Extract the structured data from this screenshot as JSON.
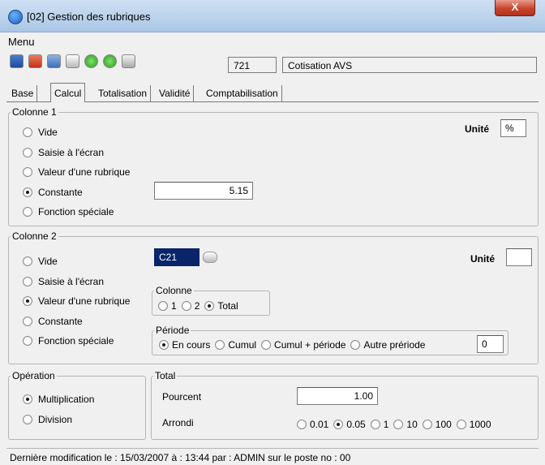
{
  "window": {
    "title": "[02] Gestion des rubriques",
    "close_label": "X"
  },
  "menu": {
    "label": "Menu"
  },
  "toolbar": {
    "buttons": [
      "save-icon",
      "delete-icon",
      "refresh-icon",
      "view-icon",
      "back-icon",
      "forward-icon",
      "print-icon"
    ],
    "code": "721",
    "name": "Cotisation AVS"
  },
  "tabs": [
    "Base",
    "Calcul",
    "Totalisation",
    "Validité",
    "Comptabilisation"
  ],
  "active_tab": "Calcul",
  "colonne1": {
    "legend": "Colonne 1",
    "options": [
      "Vide",
      "Saisie à l'écran",
      "Valeur d'une rubrique",
      "Constante",
      "Fonction spéciale"
    ],
    "selected": "Constante",
    "constante_value": "5.15",
    "unite_label": "Unité",
    "unite_value": "%"
  },
  "colonne2": {
    "legend": "Colonne 2",
    "options": [
      "Vide",
      "Saisie à l'écran",
      "Valeur d'une rubrique",
      "Constante",
      "Fonction spéciale"
    ],
    "selected": "Valeur d'une rubrique",
    "rubrique_value": "C21",
    "unite_label": "Unité",
    "unite_value": "",
    "colonne_group": {
      "legend": "Colonne",
      "opt1": "1",
      "opt2": "2",
      "opt3": "Total",
      "selected": "Total"
    },
    "periode_group": {
      "legend": "Période",
      "opt1": "En cours",
      "opt2": "Cumul",
      "opt3": "Cumul + période",
      "opt4": "Autre prériode",
      "selected": "En cours",
      "value": "0"
    }
  },
  "operation": {
    "legend": "Opération",
    "options": [
      "Multiplication",
      "Division"
    ],
    "selected": "Multiplication"
  },
  "total": {
    "legend": "Total",
    "pourcent_label": "Pourcent",
    "pourcent_value": "1.00",
    "arrondi_label": "Arrondi",
    "arrondi_options": [
      "0.01",
      "0.05",
      "1",
      "10",
      "100",
      "1000"
    ],
    "arrondi_selected": "0.05"
  },
  "status": {
    "text": "Dernière modification le : 15/03/2007 à : 13:44 par : ADMIN      sur le poste no : 00"
  },
  "colors": {
    "selection": "#0a246a",
    "close": "#c8452d",
    "titlebar": "#b9d1ea"
  }
}
